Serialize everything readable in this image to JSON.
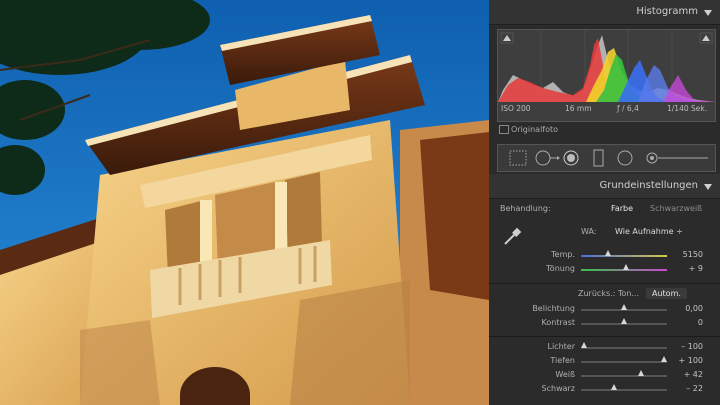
{
  "photo": {
    "description_icon": "building-photo"
  },
  "histogram": {
    "title": "Histogramm",
    "iso": "ISO 200",
    "focal": "16 mm",
    "aperture": "ƒ / 6,4",
    "shutter": "1/140 Sek.",
    "original_label": "Originalfoto"
  },
  "basic": {
    "title": "Grundeinstellungen",
    "treatment_label": "Behandlung:",
    "treatment_color": "Farbe",
    "treatment_bw": "Schwarzweiß",
    "wb_label": "WA:",
    "wb_value": "Wie Aufnahme ÷",
    "temp_label": "Temp.",
    "temp_value": "5150",
    "tint_label": "Tönung",
    "tint_value": "+ 9",
    "reset_label": "Zurücks.: Ton...",
    "auto_label": "Autom.",
    "exposure_label": "Belichtung",
    "exposure_value": "0,00",
    "contrast_label": "Kontrast",
    "contrast_value": "0",
    "highlights_label": "Lichter",
    "highlights_value": "– 100",
    "shadows_label": "Tiefen",
    "shadows_value": "+ 100",
    "whites_label": "Weiß",
    "whites_value": "+ 42",
    "blacks_label": "Schwarz",
    "blacks_value": "– 22"
  },
  "colors": {
    "panel_bg": "#2b2b2b",
    "sky": "#1b7fcf",
    "wall": "#f0c878"
  }
}
